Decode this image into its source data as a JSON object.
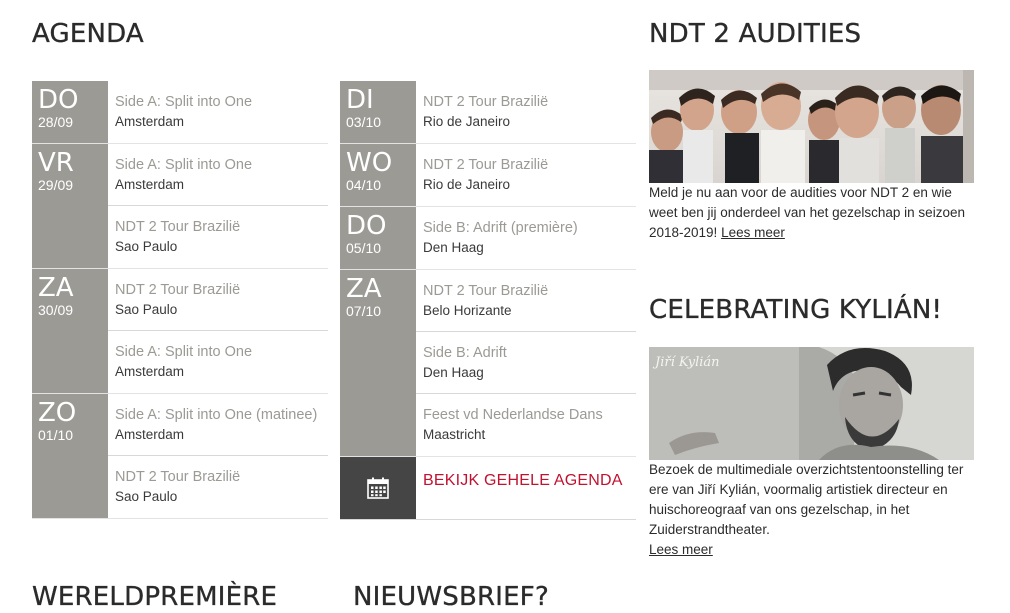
{
  "agenda": {
    "heading": "AGENDA",
    "columns": [
      [
        {
          "dow": "DO",
          "date": "28/09",
          "events": [
            {
              "title": "Side A: Split into One",
              "location": "Amsterdam"
            }
          ]
        },
        {
          "dow": "VR",
          "date": "29/09",
          "events": [
            {
              "title": "Side A: Split into One",
              "location": "Amsterdam"
            },
            {
              "title": "NDT 2 Tour Brazilië",
              "location": "Sao Paulo"
            }
          ]
        },
        {
          "dow": "ZA",
          "date": "30/09",
          "events": [
            {
              "title": "NDT 2 Tour Brazilië",
              "location": "Sao Paulo"
            },
            {
              "title": "Side A: Split into One",
              "location": "Amsterdam"
            }
          ]
        },
        {
          "dow": "ZO",
          "date": "01/10",
          "events": [
            {
              "title": "Side A: Split into One (matinee)",
              "location": "Amsterdam"
            },
            {
              "title": "NDT 2 Tour Brazilië",
              "location": "Sao Paulo"
            }
          ]
        }
      ],
      [
        {
          "dow": "DI",
          "date": "03/10",
          "events": [
            {
              "title": "NDT 2 Tour Brazilië",
              "location": "Rio de Janeiro"
            }
          ]
        },
        {
          "dow": "WO",
          "date": "04/10",
          "events": [
            {
              "title": "NDT 2 Tour Brazilië",
              "location": "Rio de Janeiro"
            }
          ]
        },
        {
          "dow": "DO",
          "date": "05/10",
          "events": [
            {
              "title": "Side B: Adrift (première)",
              "location": "Den Haag"
            }
          ]
        },
        {
          "dow": "ZA",
          "date": "07/10",
          "events": [
            {
              "title": "NDT 2 Tour Brazilië",
              "location": "Belo Horizante"
            },
            {
              "title": "Side B: Adrift",
              "location": "Den Haag"
            },
            {
              "title": "Feest vd Nederlandse Dans",
              "location": "Maastricht"
            }
          ]
        }
      ]
    ],
    "cta_label": "BEKIJK GEHELE AGENDA",
    "cta_icon": "calendar-icon",
    "colors": {
      "date_block": "#9b9a95",
      "cta_block": "#454545",
      "cta_text": "#c1122f"
    }
  },
  "auditions": {
    "heading": "NDT 2 AUDITIES",
    "text": "Meld je nu aan voor de audities voor NDT 2 en wie weet ben jij onderdeel van het gezelschap in seizoen 2018-2019!",
    "link": "Lees meer"
  },
  "kylian": {
    "heading": "CELEBRATING KYLIÁN!",
    "photo_caption": "Jiří Kylián",
    "text": "Bezoek de multimediale overzichtstentoonstelling ter ere van Jiří Kylián, voormalig artistiek directeur en huischoreograaf van ons gezelschap, in het Zuiderstrandtheater.",
    "link": "Lees meer"
  },
  "bottom": {
    "premiere_heading": "WERELDPREMIÈRE",
    "newsletter_heading": "NIEUWSBRIEF?"
  }
}
